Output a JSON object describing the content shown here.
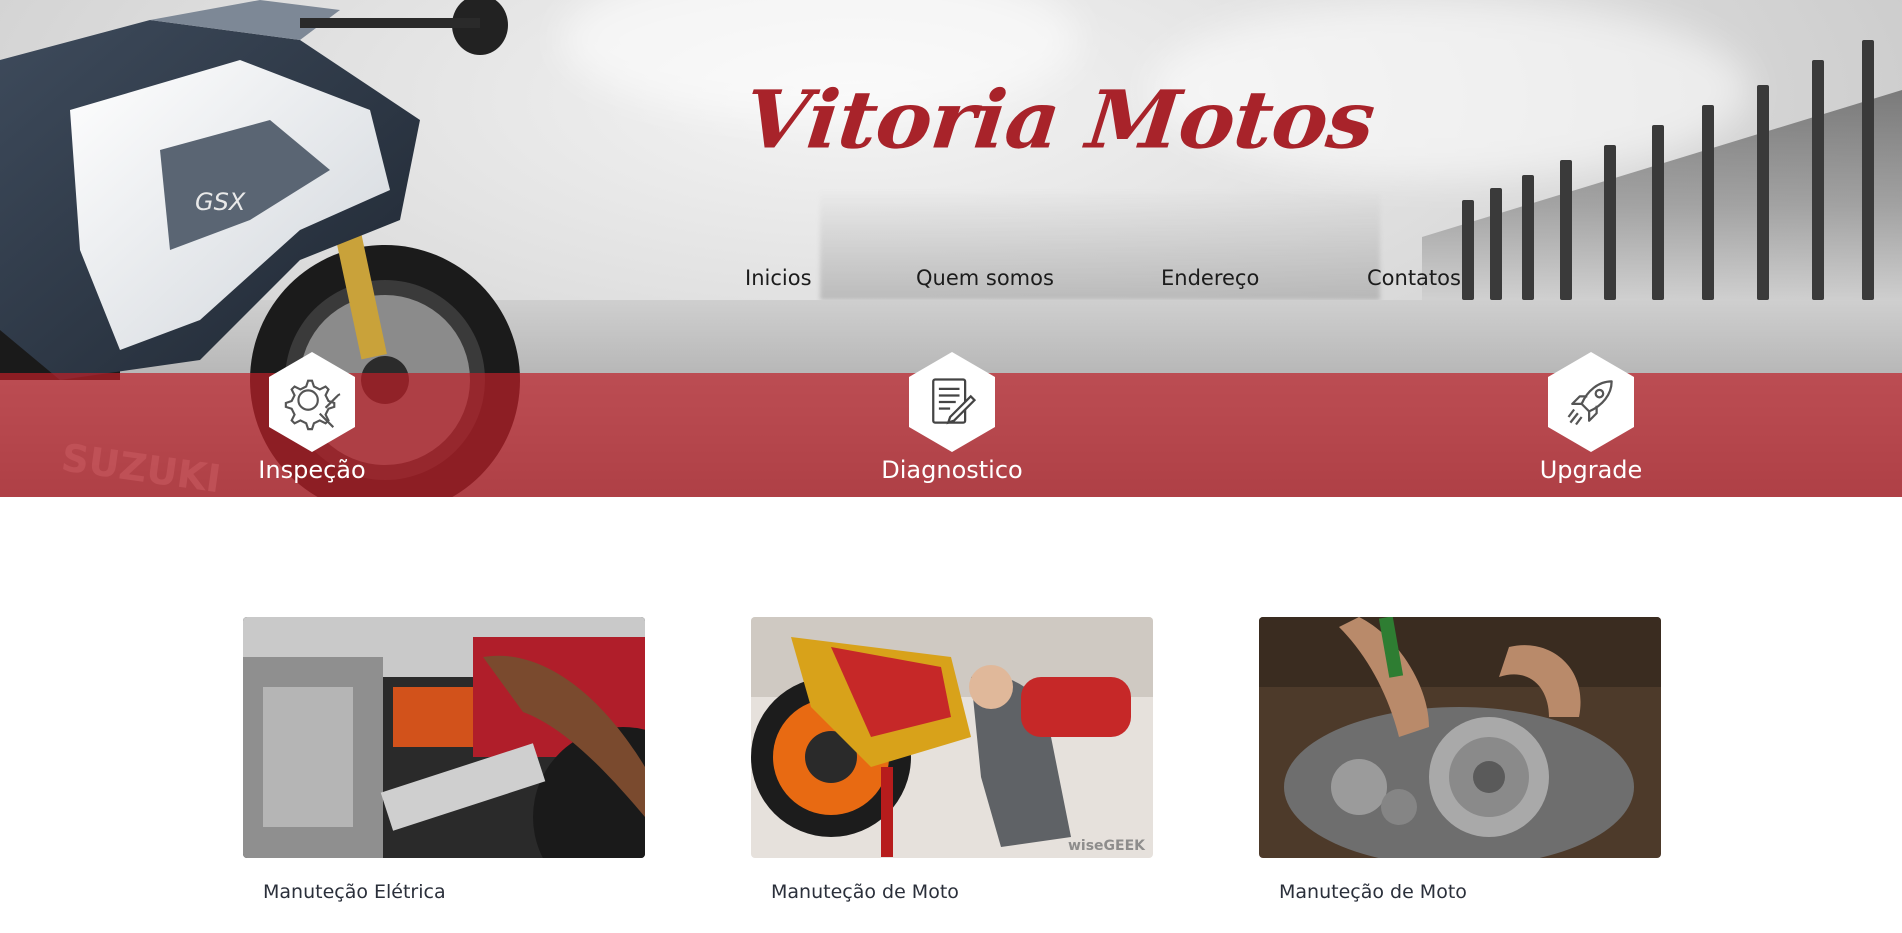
{
  "site": {
    "brand": "Vitoria Motos",
    "brand_color": "#a8232a",
    "accent_band_color": "#be2028"
  },
  "nav": {
    "items": [
      {
        "label": "Inicios"
      },
      {
        "label": "Quem somos"
      },
      {
        "label": "Endereço"
      },
      {
        "label": "Contatos"
      }
    ]
  },
  "services": [
    {
      "label": "Inspeção",
      "icon": "gear-wrench-icon"
    },
    {
      "label": "Diagnostico",
      "icon": "document-pen-icon"
    },
    {
      "label": "Upgrade",
      "icon": "rocket-icon"
    }
  ],
  "cards": [
    {
      "title": "Manuteção Elétrica",
      "image": "electrical-repair-photo"
    },
    {
      "title": "Manuteção de Moto",
      "image": "mechanic-repair-photo",
      "watermark": "wiseGEEK"
    },
    {
      "title": "Manuteção de Moto",
      "image": "engine-clutch-repair-photo"
    }
  ]
}
